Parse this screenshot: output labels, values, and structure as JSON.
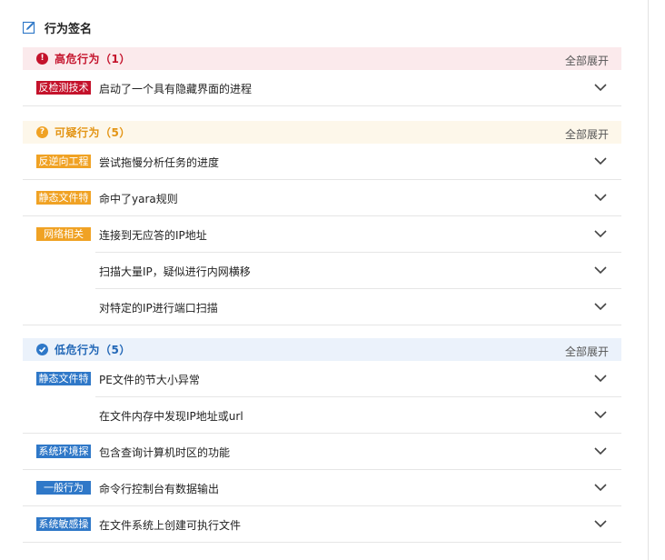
{
  "header": {
    "title": "行为签名"
  },
  "expand_all_label": "全部展开",
  "colors": {
    "high": "#c4122b",
    "suspicious": "#f0a224",
    "low": "#2f78c8"
  },
  "sections": [
    {
      "title": "高危行为（1）",
      "icon": "exclamation-icon",
      "rows": [
        {
          "tag": "反检测技术",
          "text": "启动了一个具有隐藏界面的进程"
        }
      ]
    },
    {
      "title": "可疑行为（5）",
      "icon": "question-icon",
      "rows": [
        {
          "tag": "反逆向工程",
          "text": "尝试拖慢分析任务的进度"
        },
        {
          "tag": "静态文件特",
          "text": "命中了yara规则"
        },
        {
          "tag": "网络相关",
          "text": "连接到无应答的IP地址"
        },
        {
          "tag": "",
          "text": "扫描大量IP，疑似进行内网横移"
        },
        {
          "tag": "",
          "text": "对特定的IP进行端口扫描"
        }
      ]
    },
    {
      "title": "低危行为（5）",
      "icon": "check-icon",
      "rows": [
        {
          "tag": "静态文件特",
          "text": "PE文件的节大小异常"
        },
        {
          "tag": "",
          "text": "在文件内存中发现IP地址或url"
        },
        {
          "tag": "系统环境探",
          "text": "包含查询计算机时区的功能"
        },
        {
          "tag": "一般行为",
          "text": "命令行控制台有数据输出"
        },
        {
          "tag": "系统敏感操",
          "text": "在文件系统上创建可执行文件"
        }
      ]
    }
  ]
}
